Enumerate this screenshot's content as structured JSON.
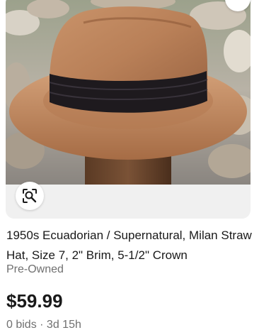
{
  "listing": {
    "title": "1950s Ecuadorian / Supernatural, Milan Straw Hat, Size 7, 2\" Brim, 5-1/2\" Crown",
    "condition": "Pre-Owned",
    "price": "$59.99",
    "bids": "0 bids",
    "separator": " · ",
    "time_left": "3d 15h"
  },
  "icons": {
    "visual_search": "visual-search-icon",
    "favorite": "heart-icon"
  },
  "colors": {
    "title": "#191919",
    "secondary": "#707070",
    "card_bg": "#f0f0f0"
  }
}
